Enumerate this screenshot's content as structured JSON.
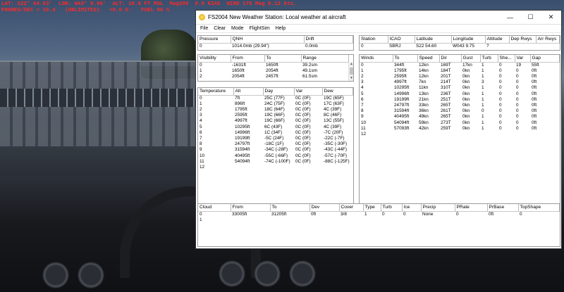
{
  "hud": {
    "line1": "LAT: S22° 54.53'  LON: W43° 9.96'  ALT: 16.9 FT MSL  Mag289  0.0 KIAS  WIND 175 Mag 0.12 kts.",
    "line2": "FRAMES/SEC = 19.4   (UNLIMITED)   +0.0 G:   FUEL 96 %"
  },
  "window": {
    "title": "FS2004 New Weather Station: Local weather at aircraft",
    "menu": [
      "File",
      "Clear",
      "Mode",
      "FlightSim",
      "Help"
    ]
  },
  "pressure": {
    "headers": [
      "Pressure",
      "QNH",
      "Drift"
    ],
    "rows": [
      [
        "0",
        "1014.0mb (29.94\")",
        "0.0mb"
      ]
    ]
  },
  "station": {
    "headers": [
      "Station",
      "ICAO",
      "Latitude",
      "Longitude",
      "Altitude",
      "Dep Rwys",
      "Arr Rwys"
    ],
    "rows": [
      [
        "0",
        "SBRJ",
        "S22 54.60",
        "W043 9.75",
        "?",
        "",
        ""
      ]
    ]
  },
  "visibility": {
    "headers": [
      "Visibility",
      "From",
      "To",
      "Range"
    ],
    "rows": [
      [
        "0",
        "-1631ft",
        "1650ft",
        "39.2sm"
      ],
      [
        "1",
        "1650ft",
        "2054ft",
        "49.1sm"
      ],
      [
        "2",
        "2054ft",
        "2457ft",
        "61.5sm"
      ]
    ]
  },
  "temperature": {
    "headers": [
      "Temperature",
      "Alt",
      "Day",
      "Var",
      "Dew"
    ],
    "rows": [
      [
        "0",
        "7ft",
        "25C (77F)",
        "0C (0F)",
        "19C (65F)"
      ],
      [
        "1",
        "896ft",
        "24C (75F)",
        "0C (0F)",
        "17C (63F)"
      ],
      [
        "2",
        "1795ft",
        "18C (64F)",
        "0C (0F)",
        "4C (39F)"
      ],
      [
        "3",
        "2595ft",
        "19C (66F)",
        "0C (0F)",
        "8C (46F)"
      ],
      [
        "4",
        "4997ft",
        "19C (66F)",
        "0C (0F)",
        "13C (55F)"
      ],
      [
        "5",
        "10295ft",
        "6C (43F)",
        "0C (0F)",
        "4C (39F)"
      ],
      [
        "6",
        "14996ft",
        "1C (34F)",
        "0C (0F)",
        "-7C (20F)"
      ],
      [
        "7",
        "19199ft",
        "-5C (24F)",
        "0C (0F)",
        "-22C (-7F)"
      ],
      [
        "8",
        "24797ft",
        "-18C (1F)",
        "0C (0F)",
        "-35C (-30F)"
      ],
      [
        "9",
        "31594ft",
        "-34C (-28F)",
        "0C (0F)",
        "-43C (-44F)"
      ],
      [
        "10",
        "40495ft",
        "-55C (-66F)",
        "0C (0F)",
        "-57C (-70F)"
      ],
      [
        "11",
        "54094ft",
        "-74C (-100F)",
        "0C (0F)",
        "-88C (-125F)"
      ],
      [
        "12",
        "",
        "",
        "",
        ""
      ]
    ]
  },
  "winds": {
    "headers": [
      "Winds",
      "To",
      "Speed",
      "Dir",
      "Gust",
      "Turb",
      "She...",
      "Var",
      "Gap"
    ],
    "rows": [
      [
        "0",
        "344ft",
        "12kn",
        "169T",
        "17kn",
        "1",
        "0",
        "19",
        "55ft"
      ],
      [
        "1",
        "1795ft",
        "14kn",
        "184T",
        "0kn",
        "1",
        "0",
        "0",
        "0ft"
      ],
      [
        "2",
        "2595ft",
        "12kn",
        "201T",
        "0kn",
        "1",
        "0",
        "0",
        "0ft"
      ],
      [
        "3",
        "4997ft",
        "7kn",
        "214T",
        "0kn",
        "3",
        "0",
        "0",
        "0ft"
      ],
      [
        "4",
        "10295ft",
        "11kn",
        "310T",
        "0kn",
        "1",
        "0",
        "0",
        "0ft"
      ],
      [
        "5",
        "14996ft",
        "13kn",
        "236T",
        "0kn",
        "1",
        "0",
        "0",
        "0ft"
      ],
      [
        "6",
        "19199ft",
        "21kn",
        "251T",
        "0kn",
        "1",
        "0",
        "0",
        "0ft"
      ],
      [
        "7",
        "24797ft",
        "33kn",
        "265T",
        "0kn",
        "1",
        "0",
        "0",
        "0ft"
      ],
      [
        "8",
        "31594ft",
        "36kn",
        "261T",
        "0kn",
        "0",
        "0",
        "0",
        "0ft"
      ],
      [
        "9",
        "40495ft",
        "49kn",
        "265T",
        "0kn",
        "1",
        "0",
        "0",
        "0ft"
      ],
      [
        "10",
        "54094ft",
        "59kn",
        "273T",
        "0kn",
        "1",
        "0",
        "0",
        "0ft"
      ],
      [
        "11",
        "57093ft",
        "42kn",
        "259T",
        "0kn",
        "1",
        "0",
        "0",
        "0ft"
      ],
      [
        "12",
        "",
        "",
        "",
        "",
        "",
        "",
        "",
        ""
      ]
    ]
  },
  "cloud": {
    "headers": [
      "Cloud",
      "From",
      "To",
      "Dev",
      "Cover",
      "Type",
      "Turb",
      "Ice",
      "Precip",
      "PRate",
      "PrBase",
      "TopShape"
    ],
    "rows": [
      [
        "0",
        "33005ft",
        "31205ft",
        "0ft",
        "3/8",
        "1",
        "0",
        "0",
        "None",
        "0",
        "0ft",
        "0"
      ],
      [
        "1",
        "",
        "",
        "",
        "",
        "",
        "",
        "",
        "",
        "",
        "",
        ""
      ]
    ]
  }
}
